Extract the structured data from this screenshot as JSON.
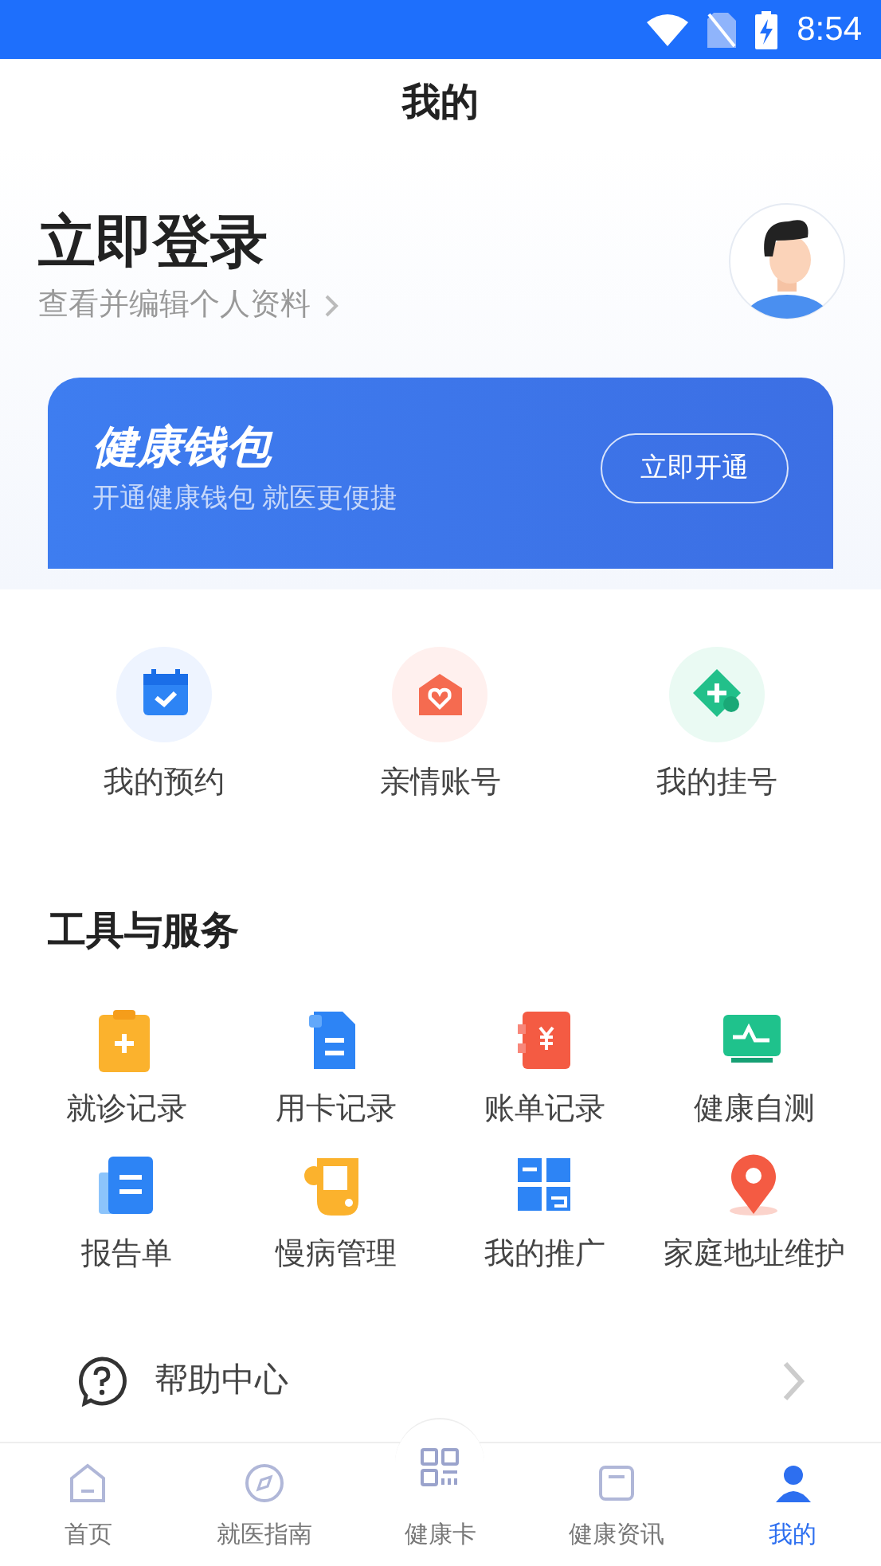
{
  "status_bar": {
    "time": "8:54"
  },
  "header": {
    "title": "我的"
  },
  "profile": {
    "title": "立即登录",
    "subtitle": "查看并编辑个人资料"
  },
  "wallet": {
    "title": "健康钱包",
    "subtitle": "开通健康钱包 就医更便捷",
    "button": "立即开通"
  },
  "quick_actions": [
    {
      "label": "我的预约",
      "kind": "calendar"
    },
    {
      "label": "亲情账号",
      "kind": "heart"
    },
    {
      "label": "我的挂号",
      "kind": "plus"
    }
  ],
  "tools": {
    "title": "工具与服务",
    "items": [
      {
        "label": "就诊记录",
        "kind": "clipboard"
      },
      {
        "label": "用卡记录",
        "kind": "document"
      },
      {
        "label": "账单记录",
        "kind": "bill"
      },
      {
        "label": "健康自测",
        "kind": "monitor"
      },
      {
        "label": "报告单",
        "kind": "report"
      },
      {
        "label": "慢病管理",
        "kind": "bag"
      },
      {
        "label": "我的推广",
        "kind": "qr"
      },
      {
        "label": "家庭地址维护",
        "kind": "pin"
      }
    ]
  },
  "help": {
    "label": "帮助中心"
  },
  "tab_bar": [
    {
      "label": "首页",
      "kind": "home",
      "selected": false
    },
    {
      "label": "就医指南",
      "kind": "compass",
      "selected": false
    },
    {
      "label": "健康卡",
      "kind": "card",
      "selected": false
    },
    {
      "label": "健康资讯",
      "kind": "news",
      "selected": false
    },
    {
      "label": "我的",
      "kind": "me",
      "selected": true
    }
  ]
}
